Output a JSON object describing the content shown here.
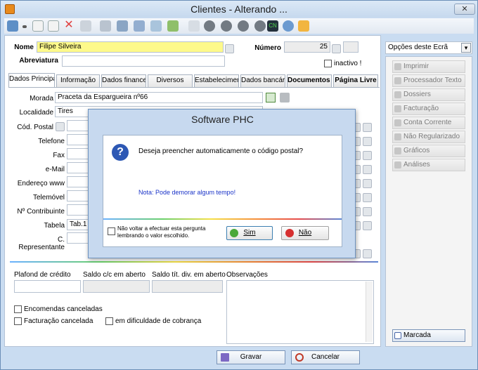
{
  "window": {
    "title": "Clientes - Alterando ...",
    "close_glyph": "✕"
  },
  "toolbar": {
    "cn_label": "CN"
  },
  "header": {
    "nome_label": "Nome",
    "nome_value": "Filipe Silveira",
    "abreviatura_label": "Abreviatura",
    "numero_label": "Número",
    "numero_value": "25",
    "inactivo_label": "inactivo !"
  },
  "tabs": [
    {
      "label": "Dados Principai"
    },
    {
      "label": "Informação"
    },
    {
      "label": "Dados financeir"
    },
    {
      "label": "Diversos"
    },
    {
      "label": "Estabeleciment"
    },
    {
      "label": "Dados bancário"
    },
    {
      "label": "Documentos de"
    },
    {
      "label": "Página Livre"
    }
  ],
  "form": {
    "morada_label": "Morada",
    "morada_value": "Praceta da Espargueira nº66",
    "localidade_label": "Localidade",
    "localidade_value": "Tires",
    "cod_postal_label": "Cód. Postal",
    "telefone_label": "Telefone",
    "fax_label": "Fax",
    "email_label": "e-Mail",
    "www_label": "Endereço www",
    "telemovel_label": "Telemóvel",
    "contribuinte_label": "Nº Contribuinte",
    "tabela_label": "Tabela",
    "tabela_value": "Tab.1",
    "representante_label": "C. Representante"
  },
  "lower": {
    "plafond_label": "Plafond de crédito",
    "saldo_cc_label": "Saldo c/c em aberto",
    "saldo_tit_label": "Saldo tít. div. em aberto",
    "obs_label": "Observações",
    "encomendas_label": "Encomendas canceladas",
    "facturacao_label": "Facturação cancelada",
    "dificuldade_label": "em dificuldade de cobrança"
  },
  "right_panel": {
    "select_value": "Opções deste Ecrã",
    "items": [
      {
        "label": "Imprimir"
      },
      {
        "label": "Processador Texto"
      },
      {
        "label": "Dossiers"
      },
      {
        "label": "Facturação"
      },
      {
        "label": "Conta Corrente"
      },
      {
        "label": "Não Regularizado"
      },
      {
        "label": "Gráficos"
      },
      {
        "label": "Análises"
      }
    ],
    "marcada_label": "Marcada"
  },
  "dialog": {
    "title": "Software PHC",
    "question": "Deseja preencher automaticamente o código postal?",
    "note": "Nota: Pode demorar algum tempo!",
    "checkbox_label_1": "Não voltar a efectuar esta pergunta",
    "checkbox_label_2": "lembrando o valor escolhido.",
    "yes_label": "Sim",
    "no_label": "Não",
    "question_icon_glyph": "?"
  },
  "footer": {
    "gravar_label": "Gravar",
    "cancelar_label": "Cancelar"
  }
}
